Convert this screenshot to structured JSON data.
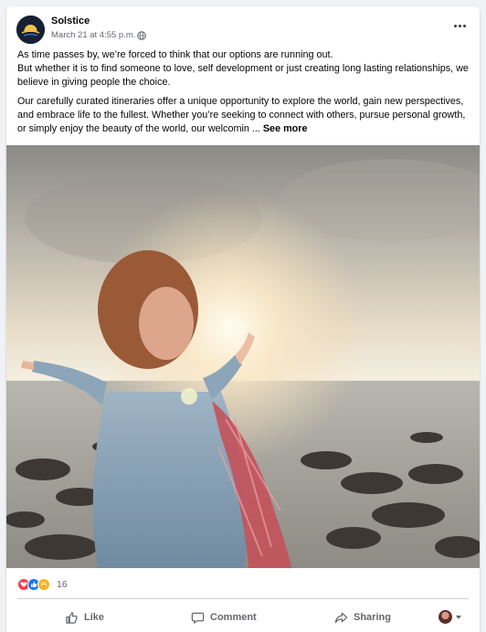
{
  "post": {
    "page_name": "Solstice",
    "timestamp": "March 21 at 4:55 p.m.",
    "privacy_icon": "globe-icon",
    "paragraph1_line1": "As time passes by, we’re forced to think that our options are running out.",
    "paragraph1_line2": "But whether it is to find someone to love, self development or just creating long lasting relationships, we believe in giving people the choice.",
    "paragraph2": "Our carefully curated itineraries offer a unique opportunity to explore the world, gain new perspectives, and embrace life to the fullest. Whether you’re seeking to connect with others, pursue personal growth, or simply enjoy the beauty of the world, our welcomin ...",
    "see_more": "See more"
  },
  "reactions": {
    "icons": [
      "love-icon",
      "like-icon",
      "care-icon"
    ],
    "count": "16"
  },
  "actions": {
    "like": "Like",
    "comment": "Comment",
    "share": "Sharing"
  },
  "colors": {
    "accent": "#1877f2",
    "love": "#f33e58",
    "care": "#f7b125",
    "muted_text": "#65676b"
  }
}
